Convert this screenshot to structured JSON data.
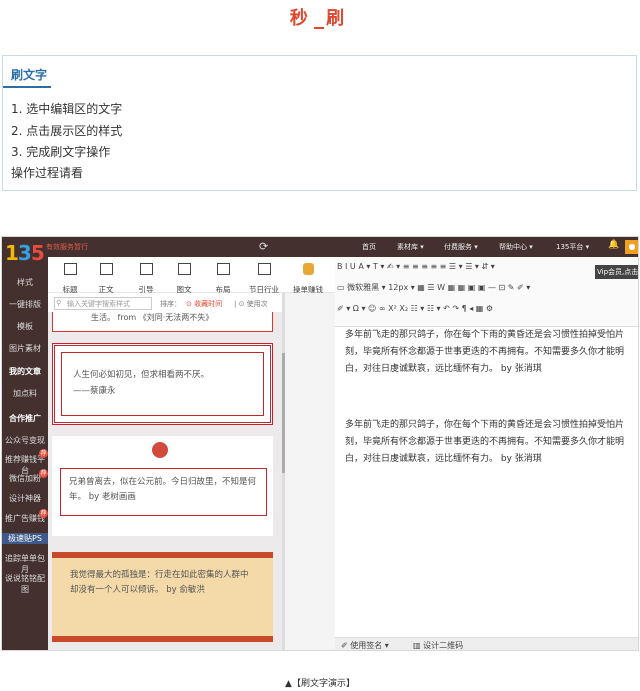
{
  "header": {
    "title": "秒 刷"
  },
  "info": {
    "label": "刷文字",
    "steps": [
      "1. 选中编辑区的文字",
      "2. 点击展示区的样式",
      "3. 完成刷文字操作",
      "操作过程请看"
    ]
  },
  "app": {
    "logo": {
      "a": "1",
      "b": "3",
      "c": "5"
    },
    "promo": "有效服务暂行",
    "nav": [
      "首页",
      "素材库 ▾",
      "付费服务 ▾",
      "帮助中心 ▾",
      "135平台 ▾"
    ],
    "sidebar": [
      "样式",
      "一键排版",
      "模板",
      "图片素材",
      "我的文章",
      "加点料",
      "合作推广",
      "公众号变现",
      "推荐赚钱平台",
      "微信加粉",
      "设计神器",
      "推广告赚钱",
      "极速贴PS",
      "追踪单单包月",
      "说说铭铭配图"
    ],
    "badges": [
      "荐",
      "荐",
      "荐"
    ],
    "tools": [
      "标题",
      "正文",
      "引导",
      "图文",
      "布局",
      "节日行业"
    ],
    "ad_tool": "操单赚钱",
    "search": {
      "placeholder": "输入关键字搜索样式",
      "sort_label": "排序：",
      "fav": "⊙ 收藏时间",
      "used": "| ⊙ 使用次"
    },
    "cards": {
      "c0": "生活。 from 《刘同·无法两不失》",
      "c1a": "人生何必如初见，但求相看两不厌。",
      "c1b": "——蔡康永",
      "c2": "兄弟曾离去，似在公元前。今日归故里，不知是何年。 by 老树画画",
      "c3": "我觉得最大的孤独是：行走在如此密集的人群中却没有一个人可以倾诉。 by 俞敏洪"
    },
    "editor_toolbar": {
      "row1": "B  I  U  A ▾  T ▾  ✍ ▾  ≡  ≡  ≡  ≡  ≡  ☰ ▾  ☰ ▾  ⇵ ▾",
      "row2": "▭  微软雅黑 ▾  12px ▾  ▦  ☰  W  ▦  ▦  ▣  ▣  —  ⊡  ✎  ✐ ▾",
      "row3": "✐ ▾  Ω ▾  ☺  ∞  X²  X₂  ☷ ▾  ☷ ▾  ↶  ↷  ¶  ◂  ▦  ⚙",
      "vip": "Vip会员,点击"
    },
    "paragraphs": [
      "多年前飞走的那只鸽子，你在每个下雨的黄昏还是会习惯性拍掉受怕片刻，毕竟所有怀念都源于世事更迭的不再拥有。不知需要多久你才能明白，对往日虔诚默哀，远比缅怀有力。 by 张消琪",
      "多年前飞走的那只鸽子，你在每个下雨的黄昏还是会习惯性拍掉受怕片刻，毕竟所有怀念都源于世事更迭的不再拥有。不知需要多久你才能明白，对往日虔诚默哀，远比缅怀有力。 by 张消琪"
    ],
    "footer_tabs": [
      "✐ 使用签名 ▾",
      "▥ 设计二维码"
    ]
  },
  "caption": "▲【刷文字演示】",
  "colors": {
    "accent": "#e0472e",
    "sidebar": "#43302f",
    "link": "#2a6fa8"
  }
}
